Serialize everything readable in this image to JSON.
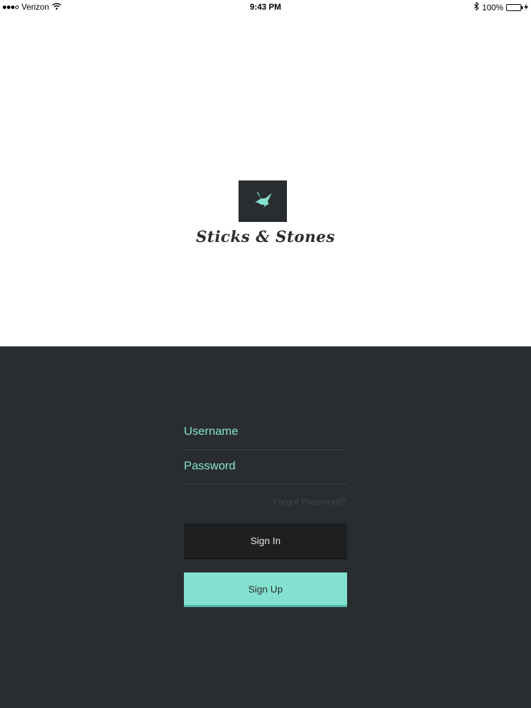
{
  "status_bar": {
    "carrier": "Verizon",
    "time": "9:43 PM",
    "battery": "100%",
    "signal_bars_filled": 3,
    "signal_bars_total": 4
  },
  "branding": {
    "app_name": "Sticks & Stones",
    "logo_icon": "bird-icon"
  },
  "login": {
    "username_placeholder": "Username",
    "username_value": "",
    "password_placeholder": "Password",
    "password_value": "",
    "forgot_password": "Forgot Password?",
    "sign_in_label": "Sign In",
    "sign_up_label": "Sign Up"
  },
  "colors": {
    "accent": "#84e1d0",
    "dark_panel": "#2a2d30",
    "sign_in_button": "#1d1f21"
  }
}
